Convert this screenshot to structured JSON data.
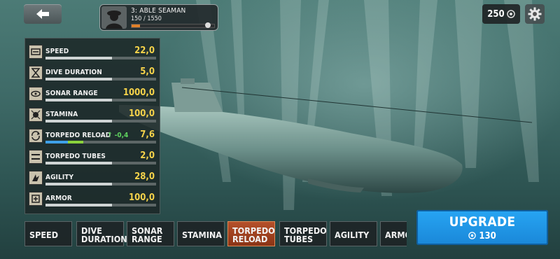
{
  "header": {
    "back_icon": "arrow-left-icon",
    "rank_title": "3: ABLE SEAMAN",
    "rank_xp": "150 / 1550",
    "rank_progress": 0.1,
    "coins": "250",
    "settings_icon": "gear-icon"
  },
  "stats": [
    {
      "name": "SPEED",
      "value": "22,0",
      "delta": "",
      "fill": 0.6,
      "icon": "speed-icon"
    },
    {
      "name": "DIVE DURATION",
      "value": "5,0",
      "delta": "",
      "fill": 0.6,
      "icon": "hourglass-icon"
    },
    {
      "name": "SONAR RANGE",
      "value": "1000,0",
      "delta": "",
      "fill": 0.6,
      "icon": "sonar-icon"
    },
    {
      "name": "STAMINA",
      "value": "100,0",
      "delta": "",
      "fill": 0.6,
      "icon": "stamina-icon"
    },
    {
      "name": "TORPEDO RELOAD",
      "value": "7,6",
      "delta": "-0,4",
      "fill": 0.2,
      "icon": "torpedo-reload-icon"
    },
    {
      "name": "TORPEDO TUBES",
      "value": "2,0",
      "delta": "",
      "fill": 0.6,
      "icon": "torpedo-tubes-icon"
    },
    {
      "name": "AGILITY",
      "value": "28,0",
      "delta": "",
      "fill": 0.6,
      "icon": "agility-icon"
    },
    {
      "name": "ARMOR",
      "value": "100,0",
      "delta": "",
      "fill": 0.6,
      "icon": "armor-icon"
    }
  ],
  "tabs": [
    "SPEED",
    "DIVE DURATION",
    "SONAR RANGE",
    "STAMINA",
    "TORPEDO RELOAD",
    "TORPEDO TUBES",
    "AGILITY",
    "ARMOR"
  ],
  "active_tab": "TORPEDO RELOAD",
  "upgrade": {
    "label": "UPGRADE",
    "cost": "130"
  },
  "colors": {
    "accent": "#1f95e6",
    "value": "#f5d24a",
    "delta": "#5fd35f",
    "active_tab": "#a4421f"
  }
}
